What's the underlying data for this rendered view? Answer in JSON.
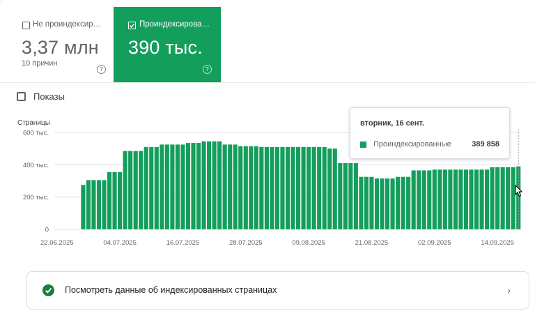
{
  "tiles": {
    "not_indexed": {
      "label": "Не проиндексир…",
      "value": "3,37 млн",
      "sub": "10 причин",
      "help": "?"
    },
    "indexed": {
      "label": "Проиндексирова…",
      "value": "390 тыс.",
      "help": "?"
    }
  },
  "impressions_label": "Показы",
  "colors": {
    "brand_green": "#149e5c",
    "grid": "#e0e0e0",
    "axis_text": "#5f6368"
  },
  "chart_data": {
    "type": "bar",
    "ylabel": "Страницы",
    "ylim": [
      0,
      600000
    ],
    "y_ticks": [
      {
        "value": 0,
        "label": "0"
      },
      {
        "value": 200000,
        "label": "200 тыс."
      },
      {
        "value": 400000,
        "label": "400 тыс."
      },
      {
        "value": 600000,
        "label": "600 тыс."
      }
    ],
    "x_ticks": [
      "22.06.2025",
      "04.07.2025",
      "16.07.2025",
      "28.07.2025",
      "09.08.2025",
      "21.08.2025",
      "02.09.2025",
      "14.09.2025"
    ],
    "x_tick_indices": [
      0,
      12,
      24,
      36,
      48,
      60,
      72,
      84
    ],
    "series": [
      {
        "name": "Проиндексированные",
        "values": [
          0,
          0,
          0,
          0,
          0,
          275000,
          305000,
          305000,
          305000,
          305000,
          355000,
          355000,
          355000,
          485000,
          485000,
          485000,
          485000,
          510000,
          510000,
          510000,
          525000,
          525000,
          525000,
          525000,
          525000,
          535000,
          535000,
          535000,
          545000,
          545000,
          545000,
          545000,
          525000,
          525000,
          525000,
          515000,
          515000,
          515000,
          515000,
          510000,
          510000,
          510000,
          510000,
          510000,
          510000,
          510000,
          510000,
          510000,
          510000,
          510000,
          510000,
          510000,
          500000,
          500000,
          410000,
          410000,
          410000,
          410000,
          325000,
          325000,
          325000,
          315000,
          315000,
          315000,
          315000,
          325000,
          325000,
          325000,
          365000,
          365000,
          365000,
          365000,
          370000,
          370000,
          370000,
          370000,
          370000,
          370000,
          370000,
          370000,
          370000,
          370000,
          370000,
          385000,
          385000,
          385000,
          385000,
          385000,
          389858
        ]
      }
    ]
  },
  "tooltip": {
    "date": "вторник, 16 сент.",
    "series": "Проиндексированные",
    "value": "389 858"
  },
  "link": {
    "text": "Посмотреть данные об индексированных страницах"
  }
}
